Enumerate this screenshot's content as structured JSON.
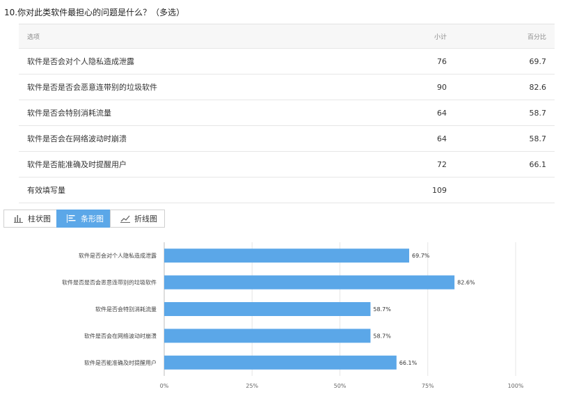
{
  "question": "10.你对此类软件最担心的问题是什么？（多选）",
  "table": {
    "headers": [
      "选项",
      "小计",
      "百分比"
    ],
    "rows": [
      {
        "option": "软件是否会对个人隐私造成泄露",
        "count": "76",
        "percent": "69.7"
      },
      {
        "option": "软件是否是否会恶意连带别的垃圾软件",
        "count": "90",
        "percent": "82.6"
      },
      {
        "option": "软件是否会特别消耗流量",
        "count": "64",
        "percent": "58.7"
      },
      {
        "option": "软件是否会在网络波动时崩溃",
        "count": "64",
        "percent": "58.7"
      },
      {
        "option": "软件是否能准确及时提醒用户",
        "count": "72",
        "percent": "66.1"
      }
    ],
    "total_label": "有效填写量",
    "total_value": "109"
  },
  "tabs": [
    {
      "label": "柱状图",
      "icon": "bar-chart-icon",
      "active": false
    },
    {
      "label": "条形图",
      "icon": "horizontal-bar-chart-icon",
      "active": true
    },
    {
      "label": "折线图",
      "icon": "line-chart-icon",
      "active": false
    }
  ],
  "chart_data": {
    "type": "bar",
    "orientation": "horizontal",
    "categories": [
      "软件是否会对个人隐私造成泄露",
      "软件是否是否会恶意连带别的垃圾软件",
      "软件是否会特别消耗流量",
      "软件是否会在网络波动时崩溃",
      "软件是否能准确及时提醒用户"
    ],
    "values": [
      69.7,
      82.6,
      58.7,
      58.7,
      66.1
    ],
    "data_labels": [
      "69.7%",
      "82.6%",
      "58.7%",
      "58.7%",
      "66.1%"
    ],
    "xlim": [
      0,
      100
    ],
    "xticks": [
      0,
      25,
      50,
      75,
      100
    ],
    "xtick_labels": [
      "0%",
      "25%",
      "50%",
      "75%",
      "100%"
    ],
    "grid": true,
    "bar_color": "#5ba7e8"
  },
  "colors": {
    "accent": "#5ba7e8"
  }
}
